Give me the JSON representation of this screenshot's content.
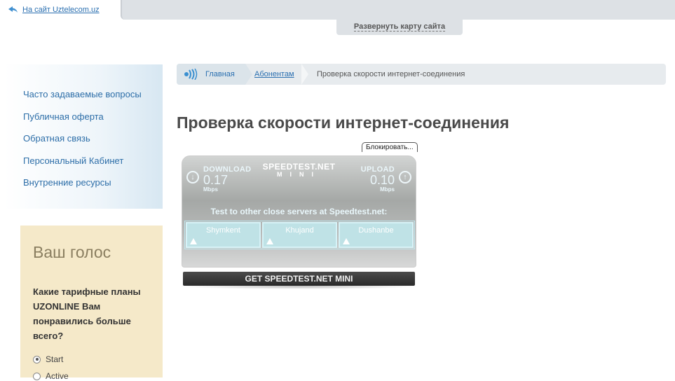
{
  "header": {
    "back_link": "На сайт Uztelecom.uz",
    "sitemap_toggle": "Развернуть карту сайта"
  },
  "sidebar": {
    "items": [
      {
        "label": "Часто задаваемые вопросы"
      },
      {
        "label": "Публичная оферта"
      },
      {
        "label": "Обратная связь"
      },
      {
        "label": "Персональный Кабинет"
      },
      {
        "label": "Внутренние ресурсы"
      }
    ]
  },
  "poll": {
    "title": "Ваш голос",
    "question": "Какие тарифные планы UZONLINE Вам понравились больше всего?",
    "options": [
      {
        "label": "Start",
        "selected": true
      },
      {
        "label": "Active",
        "selected": false
      }
    ]
  },
  "breadcrumb": {
    "home": "Главная",
    "section": "Абонентам",
    "current": "Проверка скорости интернет-соединения"
  },
  "page": {
    "title": "Проверка скорости интернет-соединения"
  },
  "block_tooltip": "Блокировать...",
  "speedtest": {
    "logo": "SPEEDTEST.NET",
    "logo_sub": "MINI",
    "download": {
      "label": "DOWNLOAD",
      "value": "0.17",
      "unit": "Mbps"
    },
    "upload": {
      "label": "UPLOAD",
      "value": "0.10",
      "unit": "Mbps"
    },
    "servers_caption": "Test to other close servers at Speedtest.net:",
    "servers": [
      {
        "name": "Shymkent"
      },
      {
        "name": "Khujand"
      },
      {
        "name": "Dushanbe"
      }
    ],
    "get_button": "GET SPEEDTEST.NET MINI"
  },
  "colors": {
    "link": "#2a6fb0",
    "poll_bg": "#f5e9c9",
    "nav_bg": "#d7e7f2",
    "speedtest_accent": "#bfe2e6"
  }
}
